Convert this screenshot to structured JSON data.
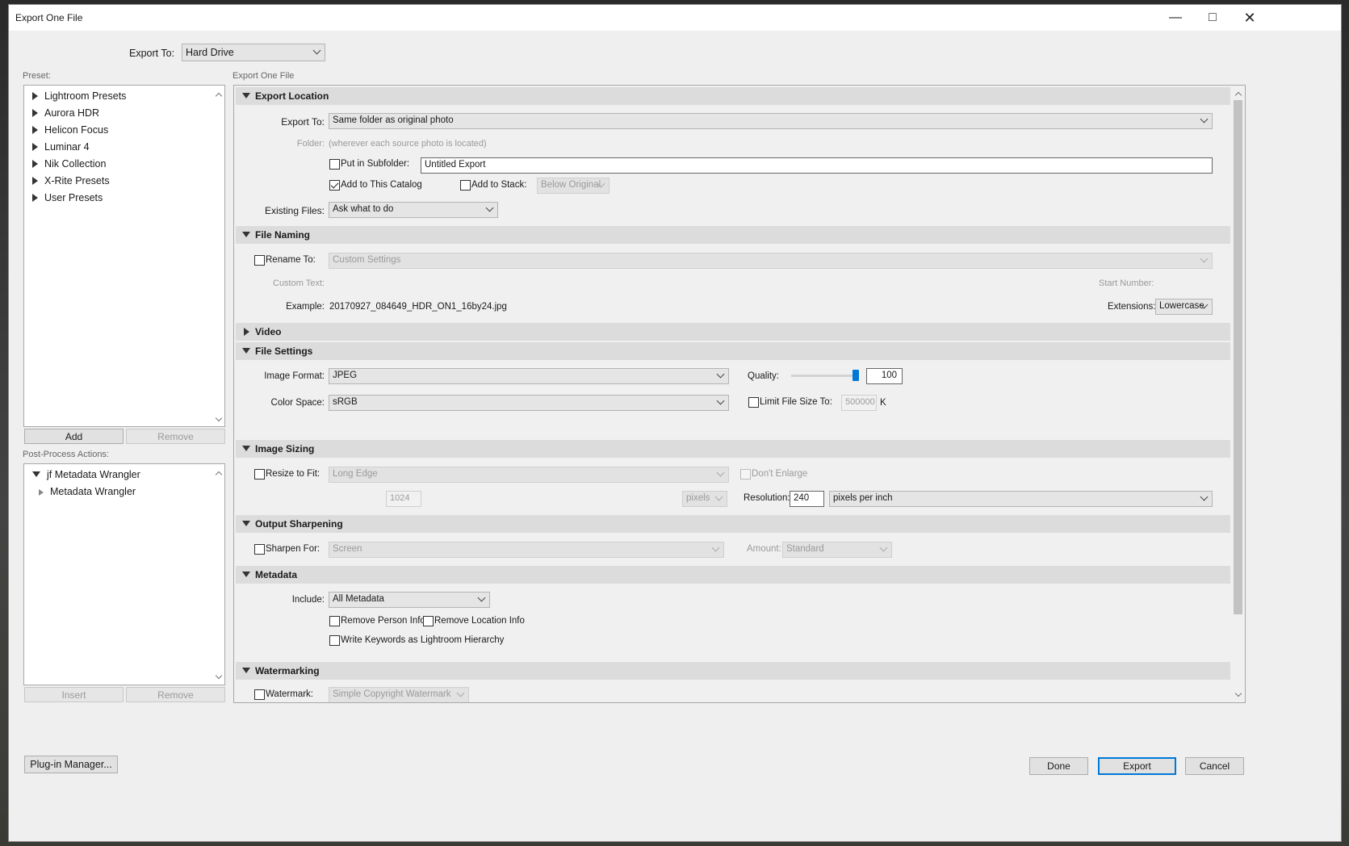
{
  "window": {
    "title": "Export One File"
  },
  "header": {
    "export_to_label": "Export To:",
    "export_to_value": "Hard Drive"
  },
  "presets": {
    "label": "Preset:",
    "items": [
      "Lightroom Presets",
      "Aurora HDR",
      "Helicon Focus",
      "Luminar 4",
      "Nik Collection",
      "X-Rite Presets",
      "User Presets"
    ],
    "add": "Add",
    "remove": "Remove"
  },
  "post_process": {
    "label": "Post-Process Actions:",
    "group": "jf Metadata Wrangler",
    "child": "Metadata Wrangler",
    "insert": "Insert",
    "remove": "Remove"
  },
  "main_label": "Export One File",
  "export_location": {
    "title": "Export Location",
    "export_to_label": "Export To:",
    "export_to_value": "Same folder as original photo",
    "folder_label": "Folder:",
    "folder_value": "(wherever each source photo is located)",
    "subfolder_label": "Put in Subfolder:",
    "subfolder_value": "Untitled Export",
    "add_catalog_label": "Add to This Catalog",
    "add_catalog_checked": true,
    "add_stack_label": "Add to Stack:",
    "stack_value": "Below Original",
    "existing_label": "Existing Files:",
    "existing_value": "Ask what to do"
  },
  "file_naming": {
    "title": "File Naming",
    "rename_label": "Rename To:",
    "rename_value": "Custom Settings",
    "custom_text_label": "Custom Text:",
    "start_number_label": "Start Number:",
    "example_label": "Example:",
    "example_value": "20170927_084649_HDR_ON1_16by24.jpg",
    "extensions_label": "Extensions:",
    "extensions_value": "Lowercase"
  },
  "video": {
    "title": "Video"
  },
  "file_settings": {
    "title": "File Settings",
    "format_label": "Image Format:",
    "format_value": "JPEG",
    "quality_label": "Quality:",
    "quality_value": "100",
    "quality_fraction": 1.0,
    "colorspace_label": "Color Space:",
    "colorspace_value": "sRGB",
    "limit_label": "Limit File Size To:",
    "limit_value": "500000",
    "limit_unit": "K"
  },
  "image_sizing": {
    "title": "Image Sizing",
    "resize_label": "Resize to Fit:",
    "resize_value": "Long Edge",
    "dont_enlarge_label": "Don't Enlarge",
    "size_value": "1024",
    "units_value": "pixels",
    "resolution_label": "Resolution:",
    "resolution_value": "240",
    "resolution_units": "pixels per inch"
  },
  "output_sharpening": {
    "title": "Output Sharpening",
    "sharpen_label": "Sharpen For:",
    "sharpen_value": "Screen",
    "amount_label": "Amount:",
    "amount_value": "Standard"
  },
  "metadata": {
    "title": "Metadata",
    "include_label": "Include:",
    "include_value": "All Metadata",
    "remove_person_label": "Remove Person Info",
    "remove_location_label": "Remove Location Info",
    "keywords_label": "Write Keywords as Lightroom Hierarchy"
  },
  "watermarking": {
    "title": "Watermarking",
    "watermark_label": "Watermark:",
    "watermark_value": "Simple Copyright Watermark"
  },
  "footer": {
    "plugin_manager": "Plug-in Manager...",
    "done": "Done",
    "export": "Export",
    "cancel": "Cancel"
  },
  "colors": {
    "accent": "#0078d7",
    "section_header": "#dcdcdc",
    "dialog_bg": "#efefef"
  }
}
